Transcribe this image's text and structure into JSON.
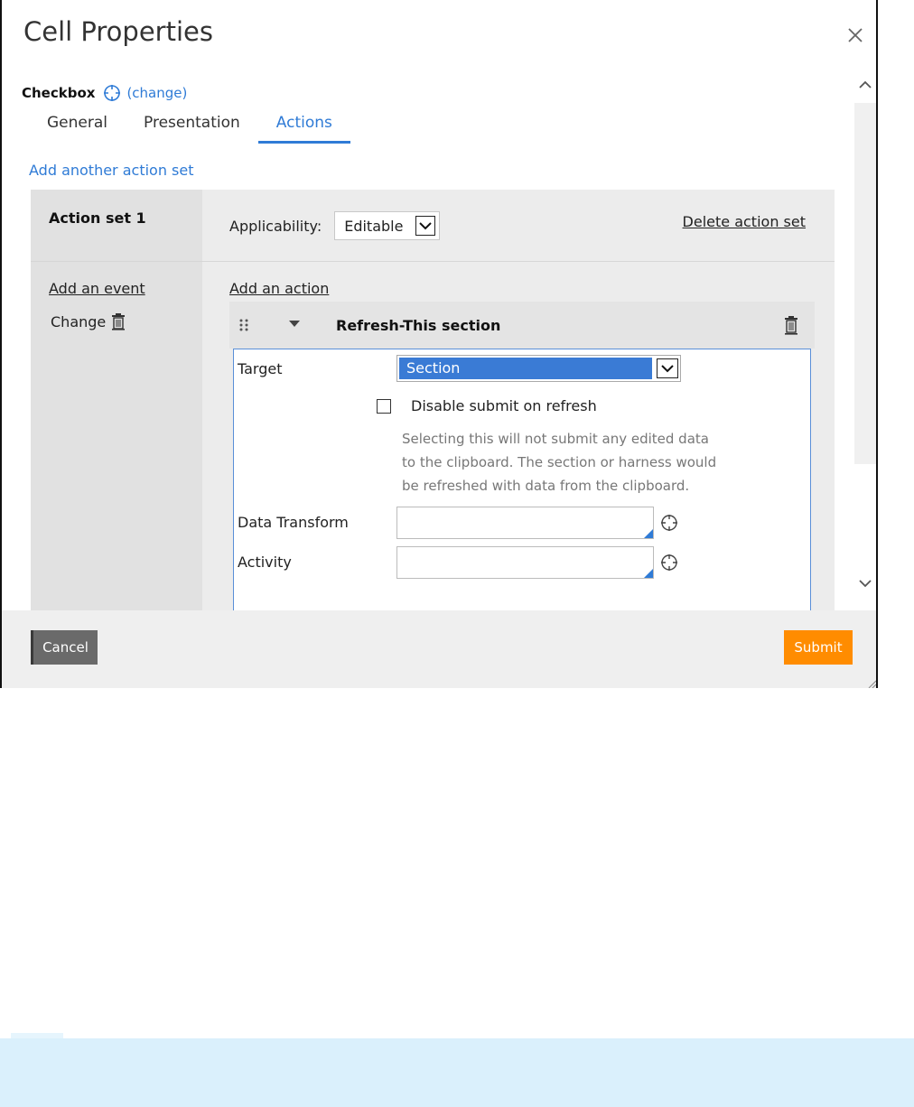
{
  "dialog": {
    "title": "Cell Properties",
    "close_icon": "close-icon"
  },
  "control": {
    "name": "Checkbox",
    "icon": "crosshair-icon",
    "change_label": "(change)"
  },
  "tabs": [
    {
      "label": "General",
      "active": false
    },
    {
      "label": "Presentation",
      "active": false
    },
    {
      "label": "Actions",
      "active": true
    }
  ],
  "add_action_set_label": "Add another action set",
  "action_set": {
    "name": "Action set 1",
    "applicability_label": "Applicability:",
    "applicability_value": "Editable",
    "delete_label": "Delete action set",
    "add_event_label": "Add an event",
    "events": [
      {
        "label": "Change",
        "icon": "trash-icon"
      }
    ],
    "add_action_label": "Add an action",
    "action": {
      "title": "Refresh-This section",
      "target_label": "Target",
      "target_value": "Section",
      "disable_submit_label": "Disable submit on refresh",
      "disable_submit_checked": false,
      "help_lines": [
        "Selecting this will not submit any edited data",
        "to the clipboard. The section or harness would",
        "be refreshed with data from the clipboard."
      ],
      "data_transform_label": "Data Transform",
      "data_transform_value": "",
      "activity_label": "Activity",
      "activity_value": ""
    }
  },
  "footer": {
    "cancel_label": "Cancel",
    "submit_label": "Submit"
  },
  "colors": {
    "link": "#2f7bd6",
    "submit": "#ff8c00",
    "cancel": "#6a6a6a",
    "selection": "#3a7bd5",
    "notice": "#daf0fc"
  }
}
